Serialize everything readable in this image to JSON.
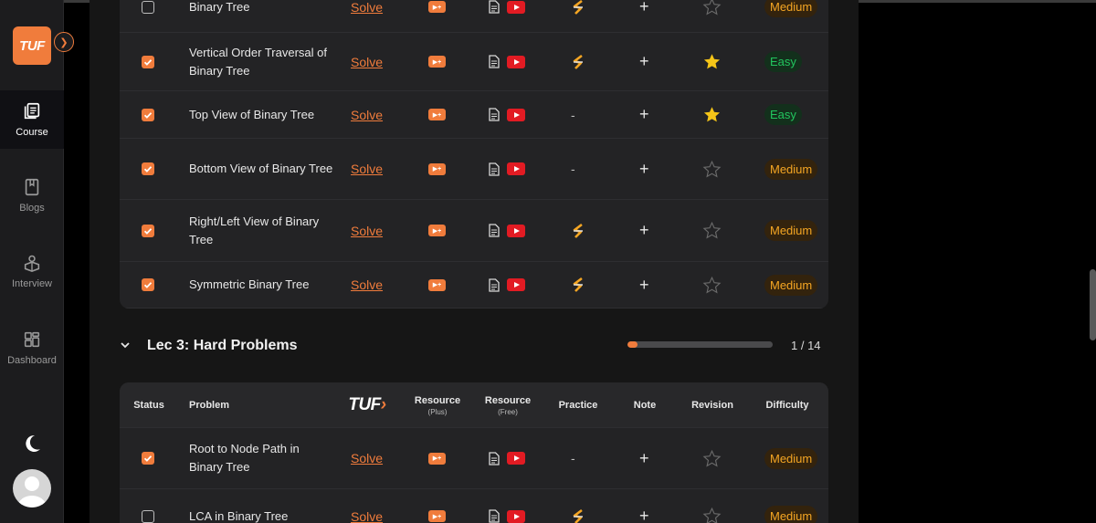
{
  "sidebar": {
    "logo": "TUF",
    "items": [
      {
        "label": "Course",
        "icon": "course-icon",
        "active": true
      },
      {
        "label": "Blogs",
        "icon": "bookmark-icon",
        "active": false
      },
      {
        "label": "Interview",
        "icon": "interview-icon",
        "active": false
      },
      {
        "label": "Dashboard",
        "icon": "dashboard-icon",
        "active": false
      }
    ]
  },
  "section1": {
    "rows": [
      {
        "checked": false,
        "name": "Binary Tree",
        "solve": "Solve",
        "practice": "codestudio",
        "note": "+",
        "revision": "empty",
        "difficulty": "Medium"
      },
      {
        "checked": true,
        "name": "Vertical Order Traversal of Binary Tree",
        "solve": "Solve",
        "practice": "codestudio",
        "note": "+",
        "revision": "filled",
        "difficulty": "Easy"
      },
      {
        "checked": true,
        "name": "Top View of Binary Tree",
        "solve": "Solve",
        "practice": "-",
        "note": "+",
        "revision": "filled",
        "difficulty": "Easy"
      },
      {
        "checked": true,
        "name": "Bottom View of Binary Tree",
        "solve": "Solve",
        "practice": "-",
        "note": "+",
        "revision": "empty",
        "difficulty": "Medium"
      },
      {
        "checked": true,
        "name": "Right/Left View of Binary Tree",
        "solve": "Solve",
        "practice": "codestudio",
        "note": "+",
        "revision": "empty",
        "difficulty": "Medium"
      },
      {
        "checked": true,
        "name": "Symmetric Binary Tree",
        "solve": "Solve",
        "practice": "codestudio",
        "note": "+",
        "revision": "empty",
        "difficulty": "Medium"
      }
    ]
  },
  "lecture": {
    "title": "Lec 3: Hard Problems",
    "progress_text": "1 / 14",
    "progress_fraction": 0.07
  },
  "table": {
    "headers": {
      "status": "Status",
      "problem": "Problem",
      "tuf": "TUF",
      "resource_plus": "Resource",
      "resource_plus_sub": "(Plus)",
      "resource_free": "Resource",
      "resource_free_sub": "(Free)",
      "practice": "Practice",
      "note": "Note",
      "revision": "Revision",
      "difficulty": "Difficulty"
    },
    "rows": [
      {
        "checked": true,
        "name": "Root to Node Path in Binary Tree",
        "solve": "Solve",
        "practice": "-",
        "note": "+",
        "revision": "empty",
        "difficulty": "Medium"
      },
      {
        "checked": false,
        "name": "LCA in Binary Tree",
        "solve": "Solve",
        "practice": "codestudio",
        "note": "+",
        "revision": "empty",
        "difficulty": "Medium"
      }
    ]
  },
  "colors": {
    "accent": "#f07c3c",
    "easy": "#22c55e",
    "medium": "#f5a623",
    "star": "#f5c518"
  }
}
